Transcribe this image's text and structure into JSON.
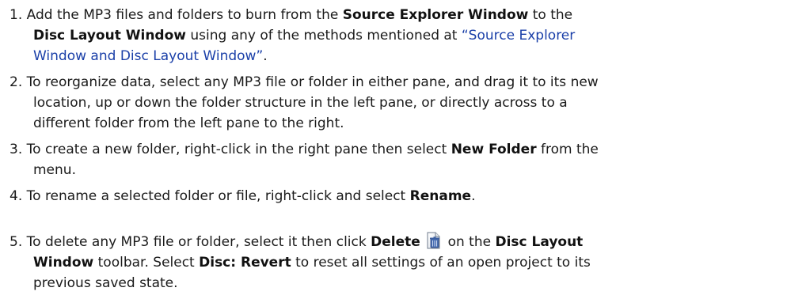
{
  "steps": [
    {
      "number": "1.",
      "t1": "Add the MP3 files and folders to burn from the ",
      "b1": "Source Explorer Window",
      "t2": " to the",
      "b2": "Disc Layout Window",
      "t3": " using any of the methods mentioned at ",
      "link1": "“Source Explorer",
      "link2": "Window and Disc Layout Window”",
      "t4": "."
    },
    {
      "number": "2.",
      "line1": "To reorganize data, select any MP3 file or folder in either pane, and drag it to its new",
      "line2": "location, up or down the folder structure in the left pane, or directly across to a",
      "line3": "different folder from the left pane to the right."
    },
    {
      "number": "3.",
      "t1": "To create a new folder, right-click in the right pane then select ",
      "b1": "New Folder",
      "t2": " from the",
      "line2": "menu."
    },
    {
      "number": "4.",
      "t1": "To rename a selected folder or file, right-click and select ",
      "b1": "Rename",
      "t2": "."
    },
    {
      "number": "5.",
      "t1": "To delete any MP3 file or folder, select it then click ",
      "b1": "Delete",
      "icon": "delete-icon",
      "t2": " on the ",
      "b2": "Disc Layout",
      "b3": "Window",
      "t3": " toolbar. Select ",
      "b4": "Disc: Revert",
      "t4": " to reset all settings of an open project to its",
      "line3": "previous saved state."
    }
  ]
}
